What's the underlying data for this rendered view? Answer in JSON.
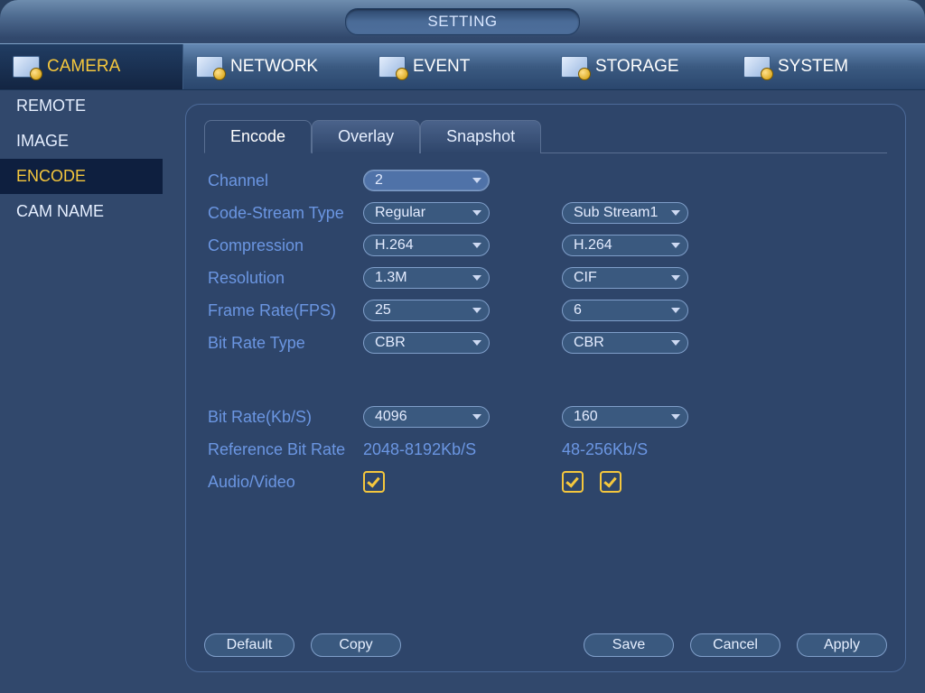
{
  "window": {
    "title": "SETTING"
  },
  "nav": {
    "items": [
      {
        "label": "CAMERA"
      },
      {
        "label": "NETWORK"
      },
      {
        "label": "EVENT"
      },
      {
        "label": "STORAGE"
      },
      {
        "label": "SYSTEM"
      }
    ]
  },
  "sidebar": {
    "items": [
      {
        "label": "REMOTE"
      },
      {
        "label": "IMAGE"
      },
      {
        "label": "ENCODE"
      },
      {
        "label": "CAM NAME"
      }
    ]
  },
  "inner_tabs": {
    "items": [
      {
        "label": "Encode"
      },
      {
        "label": "Overlay"
      },
      {
        "label": "Snapshot"
      }
    ]
  },
  "form": {
    "channel": {
      "label": "Channel",
      "main": "2"
    },
    "code_stream": {
      "label": "Code-Stream Type",
      "main": "Regular",
      "sub": "Sub Stream1"
    },
    "compression": {
      "label": "Compression",
      "main": "H.264",
      "sub": "H.264"
    },
    "resolution": {
      "label": "Resolution",
      "main": "1.3M",
      "sub": "CIF"
    },
    "frame_rate": {
      "label": "Frame Rate(FPS)",
      "main": "25",
      "sub": "6"
    },
    "bit_rate_type": {
      "label": "Bit Rate Type",
      "main": "CBR",
      "sub": "CBR"
    },
    "bit_rate": {
      "label": "Bit Rate(Kb/S)",
      "main": "4096",
      "sub": "160"
    },
    "ref_bit_rate": {
      "label": "Reference Bit Rate",
      "main": "2048-8192Kb/S",
      "sub": "48-256Kb/S"
    },
    "audio_video": {
      "label": "Audio/Video"
    }
  },
  "buttons": {
    "default": "Default",
    "copy": "Copy",
    "save": "Save",
    "cancel": "Cancel",
    "apply": "Apply"
  }
}
